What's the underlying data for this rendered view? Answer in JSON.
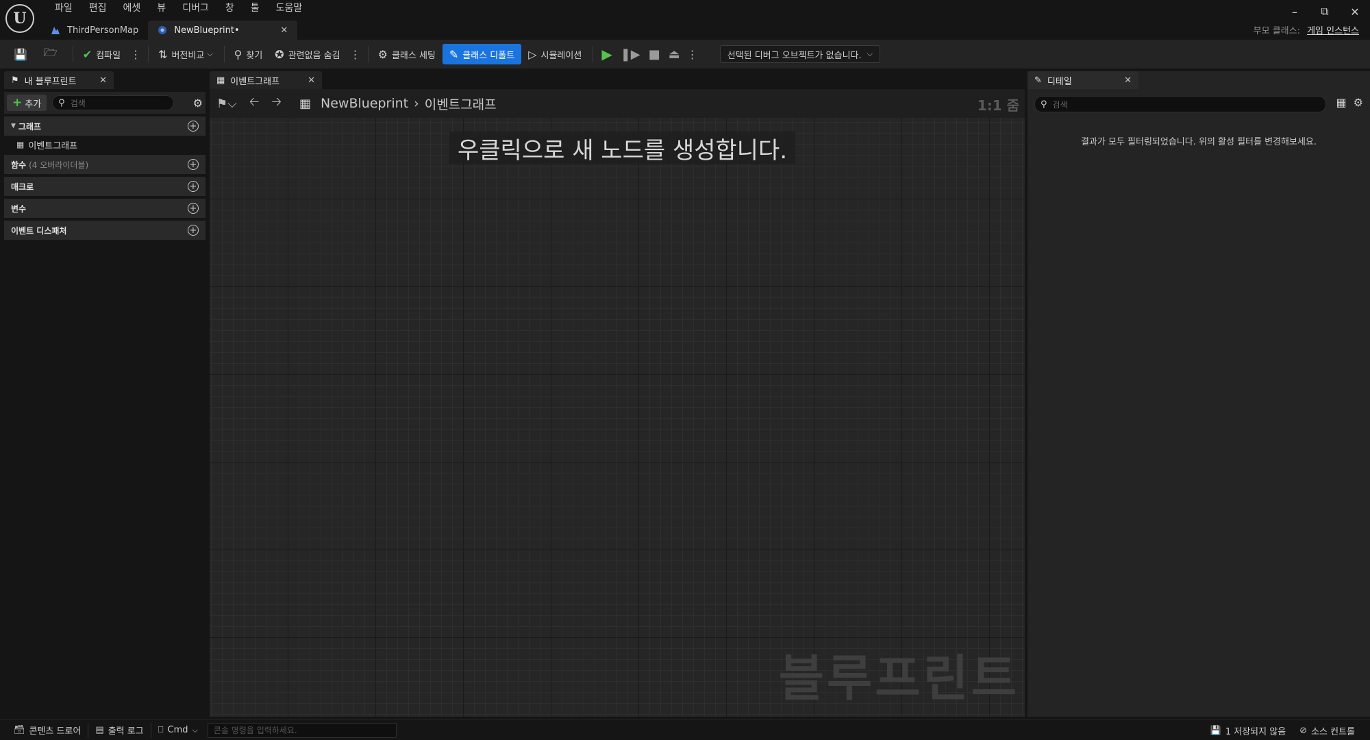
{
  "menu": [
    "파일",
    "편집",
    "에셋",
    "뷰",
    "디버그",
    "창",
    "툴",
    "도움말"
  ],
  "tabs": [
    {
      "label": "ThirdPersonMap"
    },
    {
      "label": "NewBlueprint•"
    }
  ],
  "parent_class": {
    "label": "부모 클래스:",
    "value": "게임 인스턴스"
  },
  "toolbar": {
    "compile": "컴파일",
    "diff": "버전비교",
    "find": "찾기",
    "hide_unrelated": "관련없음 숨김",
    "class_settings": "클래스 세팅",
    "class_defaults": "클래스 디폴트",
    "simulation": "시뮬레이션",
    "debug_object": "선택된 디버그 오브젝트가 없습니다."
  },
  "left_panel": {
    "tab": "내 블루프린트",
    "add": "추가",
    "search_placeholder": "검색",
    "sections": {
      "graphs": "그래프",
      "graph_item": "이벤트그래프",
      "functions": "함수",
      "functions_sub": "(4 오버라이더블)",
      "macros": "매크로",
      "variables": "변수",
      "dispatchers": "이벤트 디스패처"
    }
  },
  "graph": {
    "tab": "이벤트그래프",
    "breadcrumb_root": "NewBlueprint",
    "breadcrumb_current": "이벤트그래프",
    "zoom": "1:1 줌",
    "hint": "우클릭으로 새 노드를 생성합니다.",
    "watermark": "블루프린트"
  },
  "details": {
    "tab": "디테일",
    "search_placeholder": "검색",
    "message": "결과가 모두 필터링되었습니다. 위의 활성 필터를 변경해보세요."
  },
  "statusbar": {
    "content_drawer": "콘텐츠 드로어",
    "output_log": "출력 로그",
    "cmd": "Cmd",
    "console_placeholder": "콘솔 명령을 입력하세요.",
    "unsaved": "1 저장되지 않음",
    "source_control": "소스 컨트롤"
  },
  "colors": {
    "accent": "#1a74e0",
    "play": "#57c24f",
    "panel": "#242424",
    "background": "#151515"
  }
}
